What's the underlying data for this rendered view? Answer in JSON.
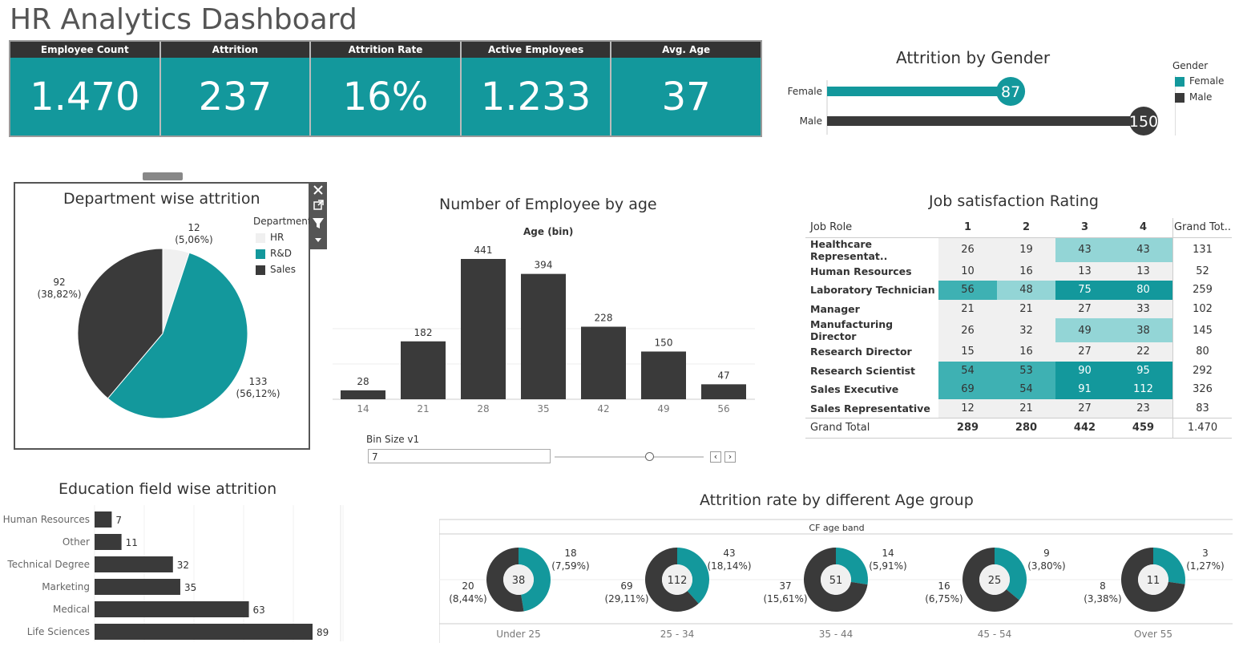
{
  "title": "HR Analytics Dashboard",
  "colors": {
    "teal": "#13989c",
    "dark": "#3a3a3a",
    "light": "#f0f0f0",
    "teal_light": "#93d5d6",
    "teal_mid": "#3eb1b3"
  },
  "kpis": [
    {
      "label": "Employee Count",
      "value": "1.470"
    },
    {
      "label": "Attrition",
      "value": "237"
    },
    {
      "label": "Attrition Rate",
      "value": "16%"
    },
    {
      "label": "Active Employees",
      "value": "1.233"
    },
    {
      "label": "Avg. Age",
      "value": "37"
    }
  ],
  "gender": {
    "title": "Attrition by Gender",
    "legend_title": "Gender",
    "legend": [
      "Female",
      "Male"
    ]
  },
  "department": {
    "title": "Department wise attrition",
    "legend_title": "Department",
    "legend": [
      "HR",
      "R&D",
      "Sales"
    ],
    "toolbar_icons": [
      "close-icon",
      "popout-icon",
      "filter-icon",
      "dropdown-icon"
    ]
  },
  "age_chart": {
    "title": "Number of Employee by age",
    "axis_title": "Age (bin)"
  },
  "bin_size": {
    "label": "Bin Size v1",
    "value": "7"
  },
  "job_satisfaction": {
    "title": "Job satisfaction Rating",
    "headers": [
      "Job Role",
      "1",
      "2",
      "3",
      "4",
      "Grand Tot.."
    ],
    "rows": [
      {
        "role": "Healthcare Representat..",
        "v": [
          "26",
          "19",
          "43",
          "43"
        ],
        "total": "131"
      },
      {
        "role": "Human Resources",
        "v": [
          "10",
          "16",
          "13",
          "13"
        ],
        "total": "52"
      },
      {
        "role": "Laboratory Technician",
        "v": [
          "56",
          "48",
          "75",
          "80"
        ],
        "total": "259"
      },
      {
        "role": "Manager",
        "v": [
          "21",
          "21",
          "27",
          "33"
        ],
        "total": "102"
      },
      {
        "role": "Manufacturing Director",
        "v": [
          "26",
          "32",
          "49",
          "38"
        ],
        "total": "145"
      },
      {
        "role": "Research Director",
        "v": [
          "15",
          "16",
          "27",
          "22"
        ],
        "total": "80"
      },
      {
        "role": "Research Scientist",
        "v": [
          "54",
          "53",
          "90",
          "95"
        ],
        "total": "292"
      },
      {
        "role": "Sales Executive",
        "v": [
          "69",
          "54",
          "91",
          "112"
        ],
        "total": "326"
      },
      {
        "role": "Sales Representative",
        "v": [
          "12",
          "21",
          "27",
          "23"
        ],
        "total": "83"
      }
    ],
    "grand_total": {
      "label": "Grand Total",
      "v": [
        "289",
        "280",
        "442",
        "459"
      ],
      "total": "1.470"
    }
  },
  "education": {
    "title": "Education field wise attrition"
  },
  "age_group": {
    "title": "Attrition rate by different Age group",
    "header": "CF age band"
  },
  "chart_data": [
    {
      "type": "bar",
      "orientation": "horizontal",
      "title": "Attrition by Gender",
      "categories": [
        "Female",
        "Male"
      ],
      "values": [
        87,
        150
      ],
      "colors": [
        "#13989c",
        "#3a3a3a"
      ]
    },
    {
      "type": "pie",
      "title": "Department wise attrition",
      "categories": [
        "HR",
        "R&D",
        "Sales"
      ],
      "values": [
        12,
        133,
        92
      ],
      "labels": [
        "12\n(5,06%)",
        "133\n(56,12%)",
        "92\n(38,82%)"
      ],
      "colors": [
        "#f0f0f0",
        "#13989c",
        "#3a3a3a"
      ]
    },
    {
      "type": "bar",
      "title": "Number of Employee by age",
      "xlabel": "Age (bin)",
      "categories": [
        "14",
        "21",
        "28",
        "35",
        "42",
        "49",
        "56"
      ],
      "values": [
        28,
        182,
        441,
        394,
        228,
        150,
        47
      ]
    },
    {
      "type": "table",
      "title": "Job satisfaction Rating"
    },
    {
      "type": "bar",
      "orientation": "horizontal",
      "title": "Education field wise attrition",
      "categories": [
        "Human Resources",
        "Other",
        "Technical Degree",
        "Marketing",
        "Medical",
        "Life Sciences"
      ],
      "values": [
        7,
        11,
        32,
        35,
        63,
        89
      ]
    },
    {
      "type": "pie",
      "variant": "donut",
      "title": "Attrition rate by different Age group",
      "header": "CF age band",
      "groups": [
        {
          "band": "Under 25",
          "total": "38",
          "teal": 18,
          "dark": 20,
          "teal_label": [
            "18",
            "(7,59%)"
          ],
          "dark_label": [
            "20",
            "(8,44%)"
          ]
        },
        {
          "band": "25 - 34",
          "total": "112",
          "teal": 43,
          "dark": 69,
          "teal_label": [
            "43",
            "(18,14%)"
          ],
          "dark_label": [
            "69",
            "(29,11%)"
          ]
        },
        {
          "band": "35 - 44",
          "total": "51",
          "teal": 14,
          "dark": 37,
          "teal_label": [
            "14",
            "(5,91%)"
          ],
          "dark_label": [
            "37",
            "(15,61%)"
          ]
        },
        {
          "band": "45 - 54",
          "total": "25",
          "teal": 9,
          "dark": 16,
          "teal_label": [
            "9",
            "(3,80%)"
          ],
          "dark_label": [
            "16",
            "(6,75%)"
          ]
        },
        {
          "band": "Over 55",
          "total": "11",
          "teal": 3,
          "dark": 8,
          "teal_label": [
            "3",
            "(1,27%)"
          ],
          "dark_label": [
            "8",
            "(3,38%)"
          ]
        }
      ]
    }
  ]
}
